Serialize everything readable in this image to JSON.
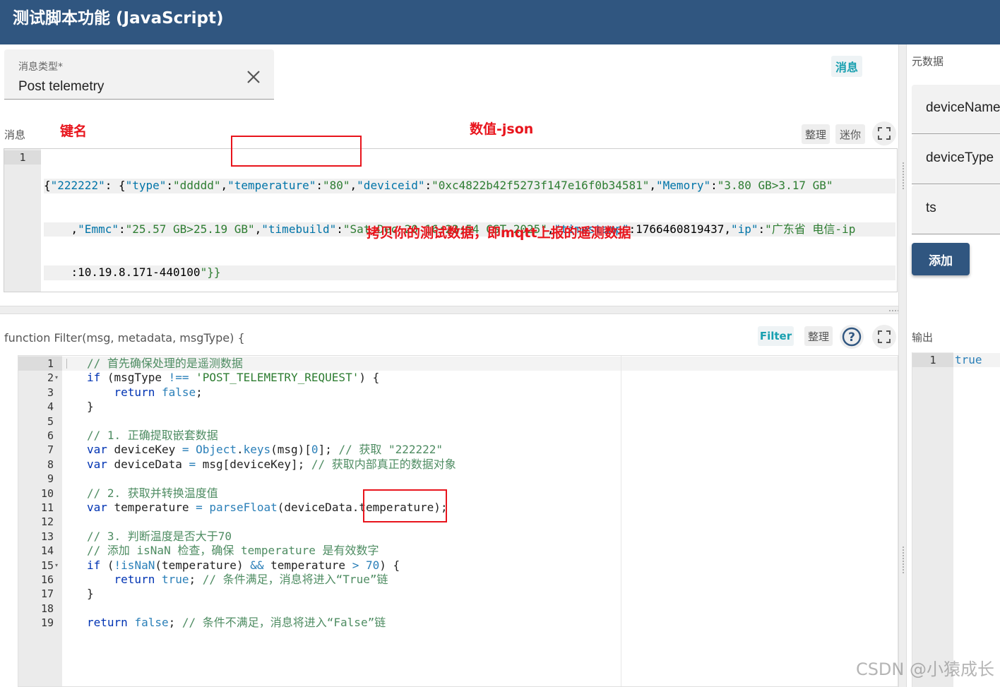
{
  "header": {
    "title": "测试脚本功能 (JavaScript)"
  },
  "message_type": {
    "label": "消息类型*",
    "value": "Post telemetry",
    "clear_icon": "close-icon"
  },
  "message_chip": "消息",
  "message_section": {
    "label": "消息",
    "format_label": "整理",
    "minify_label": "迷你",
    "line_number": "1",
    "lines": [
      "{\"222222\": {\"type\":\"ddddd\",\"temperature\":\"80\",\"deviceid\":\"0xc4822b42f5273f147e16f0b34581\",\"Memory\":\"3.80 GB>3.17 GB\"",
      "    ,\"Emmc\":\"25.57 GB>25.19 GB\",\"timebuild\":\"Sat Dec 20 16:23:54 CST 2025\",\"timestamp\":1766460819437,\"ip\":\"广东省 电信-ip",
      "    :10.19.8.171-440100\"}}"
    ]
  },
  "annotations": {
    "key_name": "键名",
    "value_json": "数值-json",
    "copy_hint": "拷贝你的测试数据，即mqtt上报的遥测数据"
  },
  "function_section": {
    "signature": "function Filter(msg, metadata, msgType) {",
    "filter_label": "Filter",
    "format_label": "整理",
    "help_icon": "help-circle-icon",
    "fullscreen_icon": "fullscreen-icon",
    "code": [
      "// 首先确保处理的是遥测数据",
      "if (msgType !== 'POST_TELEMETRY_REQUEST') {",
      "    return false;",
      "}",
      "",
      "// 1. 正确提取嵌套数据",
      "var deviceKey = Object.keys(msg)[0]; // 获取 \"222222\"",
      "var deviceData = msg[deviceKey]; // 获取内部真正的数据对象",
      "",
      "// 2. 获取并转换温度值",
      "var temperature = parseFloat(deviceData.temperature);",
      "",
      "// 3. 判断温度是否大于70",
      "// 添加 isNaN 检查，确保 temperature 是有效数字",
      "if (!isNaN(temperature) && temperature > 70) {",
      "    return true; // 条件满足，消息将进入“True”链",
      "}",
      "",
      "return false; // 条件不满足，消息将进入“False”链"
    ]
  },
  "metadata": {
    "title": "元数据",
    "items": [
      "deviceName",
      "deviceType",
      "ts"
    ],
    "add_label": "添加"
  },
  "output": {
    "title": "输出",
    "line_number": "1",
    "value": "true"
  },
  "watermark": "CSDN @小猿成长"
}
